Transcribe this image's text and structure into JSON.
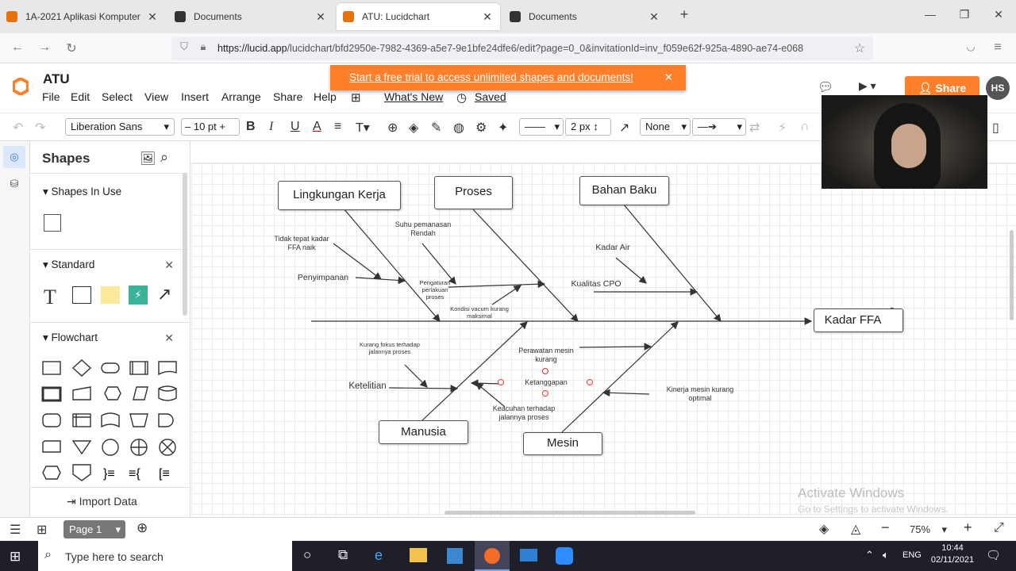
{
  "browser": {
    "tabs": [
      {
        "title": "1A-2021 Aplikasi Komputer",
        "active": false,
        "color": "#e8710a"
      },
      {
        "title": "Documents",
        "active": false,
        "color": "#333333"
      },
      {
        "title": "ATU: Lucidchart",
        "active": true,
        "color": "#e8710a"
      },
      {
        "title": "Documents",
        "active": false,
        "color": "#333333"
      }
    ],
    "new_tab": "+",
    "url_host": "https://lucid.app",
    "url_path": "/lucidchart/bfd2950e-7982-4369-a5e7-9e1bfe24dfe6/edit?page=0_0&invitationId=inv_f059e62f-925a-4890-ae74-e068"
  },
  "app": {
    "doc_title": "ATU",
    "menus": [
      "File",
      "Edit",
      "Select",
      "View",
      "Insert",
      "Arrange",
      "Share",
      "Help"
    ],
    "whats_new": "What's New",
    "saved": "Saved",
    "trial_banner": "Start a free trial to access unlimited shapes and documents!",
    "share_label": "Share",
    "avatar": "HS",
    "accent": "#ff7f2a"
  },
  "toolbar": {
    "font": "Liberation Sans",
    "font_size": "10 pt",
    "line_width": "2 px",
    "arrow_start": "None"
  },
  "shapes_panel": {
    "title": "Shapes",
    "in_use": "Shapes In Use",
    "standard": "Standard",
    "flowchart": "Flowchart",
    "import_data": "Import Data"
  },
  "diagram": {
    "categories": {
      "lingkungan": "Lingkungan Kerja",
      "proses": "Proses",
      "bahan": "Bahan Baku",
      "manusia": "Manusia",
      "mesin": "Mesin",
      "head": "Kadar FFA"
    },
    "causes": {
      "tidak_tepat": "Tidak tepat kadar FFA naik",
      "penyimpanan": "Penyimpanan",
      "suhu": "Suhu pemanasan Rendah",
      "pengaturan": "Pengaturan perlakuan proses",
      "kondisi": "Kondisi vacum kurang maksimal",
      "kadar_air": "Kadar Air",
      "kualitas": "Kualitas CPO",
      "kurang_fokus": "Kurang fokus terhadap jalannya proses",
      "ketelitian": "Ketelitian",
      "perawatan": "Perawatan mesin kurang",
      "ketanggapan": "Ketanggapan",
      "keacuhan": "Keacuhan terhadap jalannya proses",
      "kinerja": "Kinerja mesin kurang optimal"
    }
  },
  "watermark": {
    "line1": "Activate Windows",
    "line2": "Go to Settings to activate Windows."
  },
  "bottom": {
    "page": "Page 1",
    "zoom": "75%"
  },
  "taskbar": {
    "search": "Type here to search",
    "lang": "ENG",
    "time": "10:44",
    "date": "02/11/2021"
  }
}
